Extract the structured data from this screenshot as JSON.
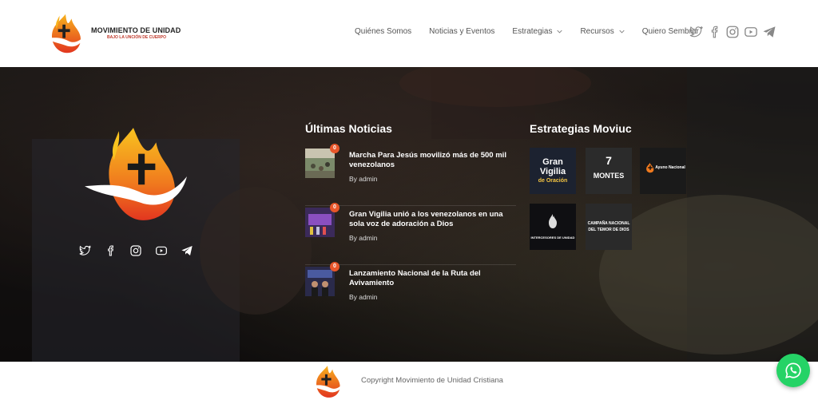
{
  "brand": {
    "name": "MOVIMIENTO DE UNIDAD",
    "tagline": "BAJO LA UNCIÓN DE CUERPO"
  },
  "nav": {
    "items": [
      {
        "label": "Quiénes Somos",
        "dropdown": false
      },
      {
        "label": "Noticias y Eventos",
        "dropdown": false
      },
      {
        "label": "Estrategias",
        "dropdown": true
      },
      {
        "label": "Recursos",
        "dropdown": true
      },
      {
        "label": "Quiero Sembrar",
        "dropdown": false
      }
    ],
    "social_icons": [
      "twitter-icon",
      "facebook-icon",
      "instagram-icon",
      "youtube-icon",
      "telegram-icon"
    ]
  },
  "hero": {
    "social_icons": [
      "twitter-icon",
      "facebook-icon",
      "instagram-icon",
      "youtube-icon",
      "telegram-icon"
    ],
    "news": {
      "title": "Últimas Noticias",
      "items": [
        {
          "headline": "Marcha Para Jesús movilizó más de 500 mil venezolanos",
          "meta": "By admin",
          "badge": "0"
        },
        {
          "headline": "Gran Vigilia unió a los venezolanos en una sola voz de adoración a Dios",
          "meta": "By admin",
          "badge": "0"
        },
        {
          "headline": "Lanzamiento Nacional de la Ruta del Avivamiento",
          "meta": "By admin",
          "badge": "0"
        }
      ]
    },
    "strategies": {
      "title": "Estrategias Moviuc",
      "tiles": [
        {
          "line1": "Gran",
          "line2": "Vigilia",
          "line3": "de Oración"
        },
        {
          "line1": "7",
          "line2": "MONTES",
          "line3": ""
        },
        {
          "line1": "Ayuno Nacional",
          "line2": "",
          "line3": ""
        },
        {
          "line1": "INTERCESORES DE UNIDAD",
          "line2": "",
          "line3": ""
        },
        {
          "line1": "CAMPAÑA NACIONAL",
          "line2": "DEL TEMOR DE DIOS",
          "line3": ""
        }
      ]
    }
  },
  "footer": {
    "copyright": "Copyright  Movimiento de Unidad Cristiana"
  },
  "colors": {
    "accent": "#e8562a",
    "flame_orange": "#f39c12",
    "flame_red": "#e74c3c",
    "whatsapp": "#25d366"
  }
}
